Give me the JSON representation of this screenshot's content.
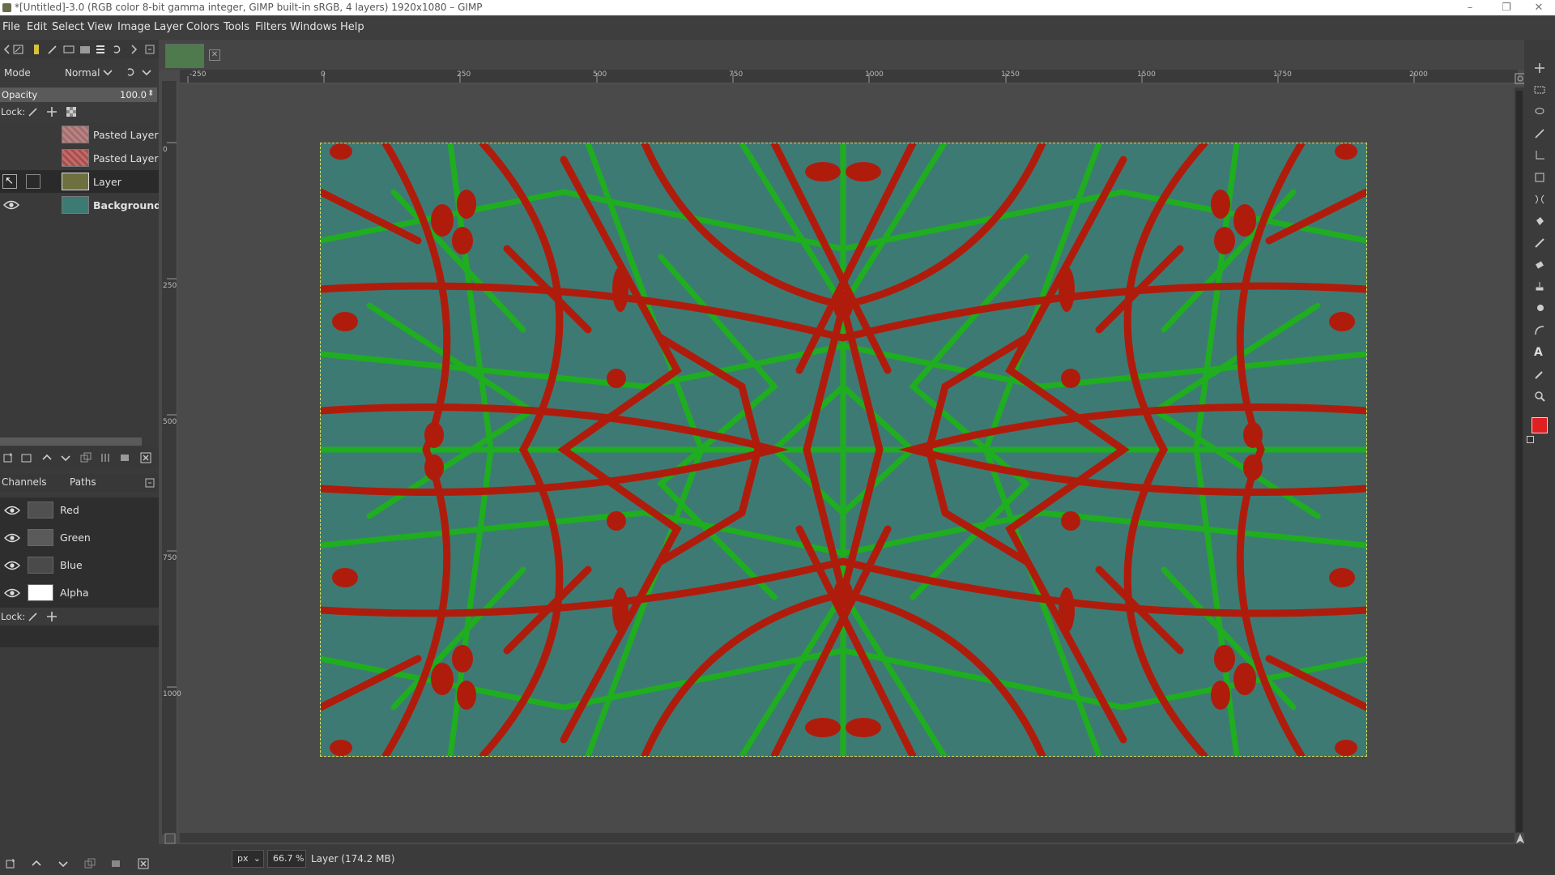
{
  "window": {
    "title": "*[Untitled]-3.0 (RGB color 8-bit gamma integer, GIMP built-in sRGB, 4 layers) 1920x1080 – GIMP",
    "min": "–",
    "max": "❐",
    "close": "✕"
  },
  "menubar": [
    "File",
    "Edit",
    "Select",
    "View",
    "Image",
    "Layer",
    "Colors",
    "Tools",
    "Filters",
    "Windows",
    "Help"
  ],
  "layers_panel": {
    "mode_label": "Mode",
    "mode_value": "Normal",
    "opacity_label": "Opacity",
    "opacity_value": "100.0",
    "lock_label": "Lock:",
    "layers": [
      {
        "name": "Pasted Layer",
        "visible": false,
        "thumb": "pattern-red"
      },
      {
        "name": "Pasted Layer",
        "visible": false,
        "thumb": "pattern-red2"
      },
      {
        "name": "Layer",
        "visible": false,
        "selected": true,
        "thumb": "olive"
      },
      {
        "name": "Background",
        "visible": true,
        "thumb": "teal"
      }
    ]
  },
  "channels_panel": {
    "tab_channels": "Channels",
    "tab_paths": "Paths",
    "lock_label": "Lock:",
    "channels": [
      {
        "name": "Red",
        "thumb": "#505050"
      },
      {
        "name": "Green",
        "thumb": "#5a5a5a"
      },
      {
        "name": "Blue",
        "thumb": "#4a4a4a"
      },
      {
        "name": "Alpha",
        "thumb": "#ffffff"
      }
    ]
  },
  "ruler": {
    "top_labels": [
      "-250",
      "0",
      "250",
      "500",
      "750",
      "1000",
      "1250",
      "1500",
      "1750",
      "2000"
    ],
    "left_labels": [
      "0",
      "250",
      "500",
      "750",
      "1000"
    ]
  },
  "statusbar": {
    "unit": "px",
    "zoom": "66.7 %",
    "info": "Layer (174.2 MB)"
  },
  "colors": {
    "foreground": "#e02020",
    "background": "#ffffff",
    "image_base": "#3e7a74",
    "line_red": "#b01c0c",
    "line_green": "#1fae1f"
  },
  "icons": {
    "eye": "eye-icon",
    "chain": "chain-icon",
    "tool_icons": [
      "move-tool-icon",
      "rect-select-icon",
      "lasso-icon",
      "fuzzy-select-icon",
      "crop-icon",
      "transform-icon",
      "warp-icon",
      "bucket-icon",
      "paintbrush-icon",
      "eraser-icon",
      "clone-icon",
      "smudge-icon",
      "path-icon",
      "text-icon",
      "color-picker-icon",
      "zoom-icon"
    ]
  }
}
